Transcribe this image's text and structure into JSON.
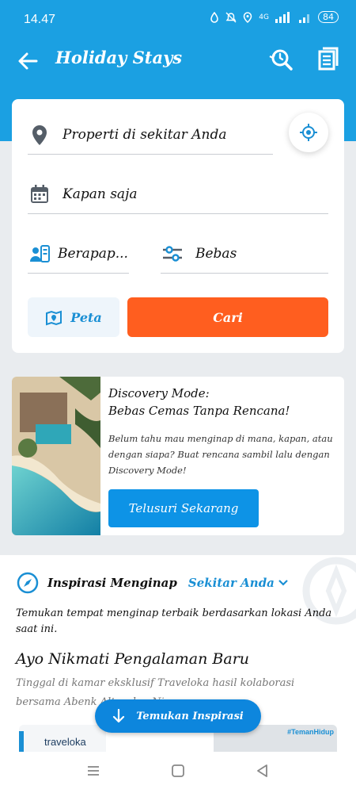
{
  "status": {
    "time": "14.47",
    "network": "4G",
    "battery": "84"
  },
  "header": {
    "title": "Holiday Stays"
  },
  "search": {
    "location": "Properti di sekitar Anda",
    "date": "Kapan saja",
    "guests": "Berapap...",
    "filter": "Bebas",
    "map_button": "Peta",
    "search_button": "Cari"
  },
  "banner": {
    "title_line1": "Discovery Mode:",
    "title_line2": "Bebas Cemas Tanpa Rencana!",
    "desc": "Belum tahu mau menginap di mana, kapan, atau dengan siapa? Buat rencana sambil lalu dengan Discovery Mode!",
    "button": "Telusuri Sekarang"
  },
  "inspiration": {
    "title": "Inspirasi Menginap",
    "selector": "Sekitar Anda",
    "desc": "Temukan tempat menginap terbaik berdasarkan lokasi Anda saat ini.",
    "heading": "Ayo Nikmati Pengalaman Baru",
    "sub": "Tinggal di kamar eksklusif Traveloka hasil kolaborasi bersama Abenk Alter dan Nina",
    "thumb_brand": "traveloka",
    "thumb_tag": "#TemanHidup",
    "fab": "Temukan Inspirasi"
  },
  "colors": {
    "primary": "#1ba0e2",
    "accent": "#ff5e1f",
    "button_blue": "#0d93e6"
  }
}
